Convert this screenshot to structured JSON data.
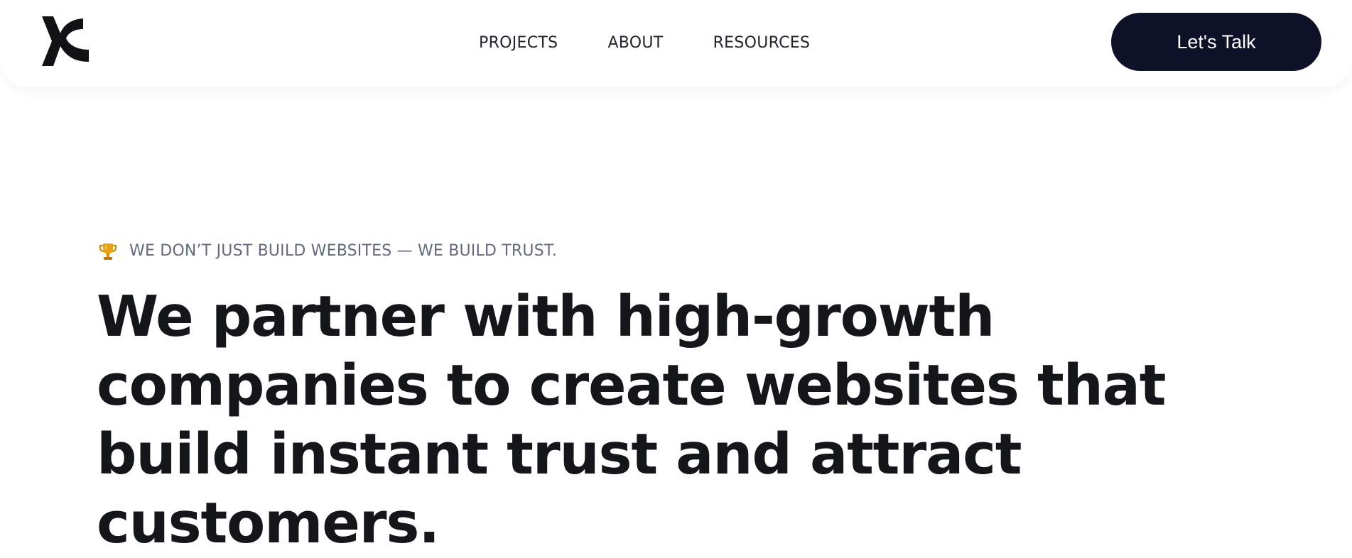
{
  "header": {
    "logo_icon": "x-brand-mark-icon",
    "nav": [
      {
        "label": "PROJECTS"
      },
      {
        "label": "ABOUT"
      },
      {
        "label": "RESOURCES"
      }
    ],
    "cta_label": "Let's Talk"
  },
  "hero": {
    "eyebrow_icon": "trophy-icon",
    "eyebrow": "WE DON’T JUST BUILD WEBSITES — WE BUILD TRUST.",
    "title_lines": [
      "We partner with high-growth",
      "companies to create websites that",
      "build instant trust and attract",
      "customers."
    ]
  },
  "colors": {
    "background": "#ffffff",
    "text": "#15161a",
    "muted_text": "#636a7e",
    "cta_background": "#0e1128",
    "cta_text": "#ffffff",
    "trophy": "#e8a317"
  }
}
